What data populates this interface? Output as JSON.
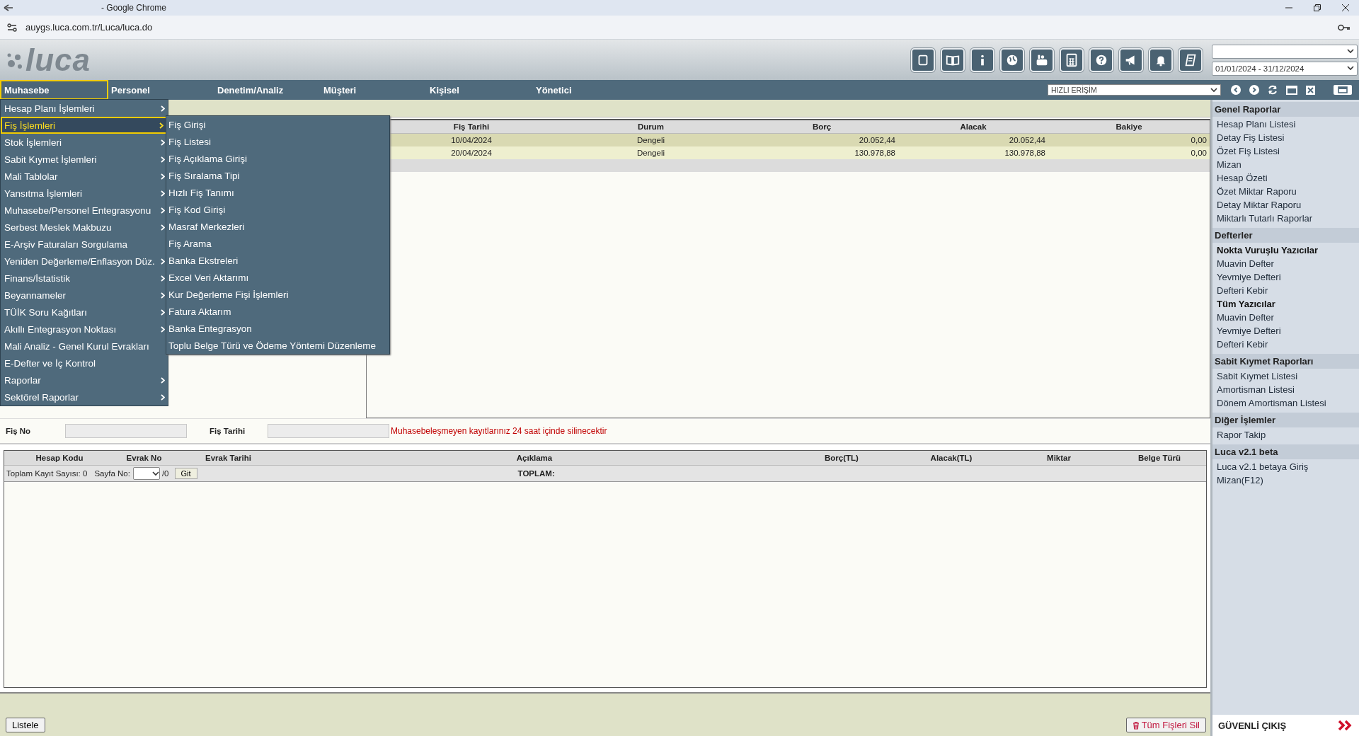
{
  "browser": {
    "title": "- Google Chrome",
    "url": "auygs.luca.com.tr/Luca/luca.do"
  },
  "header": {
    "logo": "luca",
    "period": "01/01/2024 - 31/12/2024"
  },
  "nav": {
    "items": [
      {
        "label": "Muhasebe",
        "selected": true
      },
      {
        "label": "Personel",
        "selected": false
      },
      {
        "label": "Denetim/Analiz",
        "selected": false
      },
      {
        "label": "Müşteri",
        "selected": false
      },
      {
        "label": "Kişisel",
        "selected": false
      },
      {
        "label": "Yönetici",
        "selected": false
      }
    ],
    "quick_access": "HIZLI ERİŞİM"
  },
  "menu": {
    "items": [
      {
        "label": "Hesap Planı İşlemleri",
        "has_submenu": true,
        "selected": false
      },
      {
        "label": "Fiş İşlemleri",
        "has_submenu": true,
        "selected": true
      },
      {
        "label": "Stok İşlemleri",
        "has_submenu": true,
        "selected": false
      },
      {
        "label": "Sabit Kıymet İşlemleri",
        "has_submenu": true,
        "selected": false
      },
      {
        "label": "Mali Tablolar",
        "has_submenu": true,
        "selected": false
      },
      {
        "label": "Yansıtma İşlemleri",
        "has_submenu": true,
        "selected": false
      },
      {
        "label": "Muhasebe/Personel Entegrasyonu",
        "has_submenu": true,
        "selected": false
      },
      {
        "label": "Serbest Meslek Makbuzu",
        "has_submenu": true,
        "selected": false
      },
      {
        "label": "E-Arşiv Faturaları Sorgulama",
        "has_submenu": false,
        "selected": false
      },
      {
        "label": "Yeniden Değerleme/Enflasyon Düz.",
        "has_submenu": true,
        "selected": false
      },
      {
        "label": "Finans/İstatistik",
        "has_submenu": true,
        "selected": false
      },
      {
        "label": "Beyannameler",
        "has_submenu": true,
        "selected": false
      },
      {
        "label": "TÜİK Soru Kağıtları",
        "has_submenu": true,
        "selected": false
      },
      {
        "label": "Akıllı Entegrasyon Noktası",
        "has_submenu": true,
        "selected": false
      },
      {
        "label": "Mali Analiz - Genel Kurul Evrakları",
        "has_submenu": false,
        "selected": false
      },
      {
        "label": "E-Defter ve İç Kontrol",
        "has_submenu": false,
        "selected": false
      },
      {
        "label": "Raporlar",
        "has_submenu": true,
        "selected": false
      },
      {
        "label": "Sektörel Raporlar",
        "has_submenu": true,
        "selected": false
      }
    ]
  },
  "submenu": {
    "items": [
      "Fiş Girişi",
      "Fiş Listesi",
      "Fiş Açıklama Girişi",
      "Fiş Sıralama Tipi",
      "Hızlı Fiş Tanımı",
      "Fiş Kod Girişi",
      "Masraf Merkezleri",
      "Fiş Arama",
      "Banka Ekstreleri",
      "Excel Veri Aktarımı",
      "Kur Değerleme Fişi İşlemleri",
      "Fatura Aktarım",
      "Banka Entegrasyon",
      "Toplu Belge Türü ve Ödeme Yöntemi Düzenleme"
    ]
  },
  "voucher_table": {
    "columns": [
      "Fiş Tarihi",
      "Durum",
      "Borç",
      "Alacak",
      "Bakiye"
    ],
    "rows": [
      [
        "10/04/2024",
        "Dengeli",
        "20.052,44",
        "20.052,44",
        "0,00"
      ],
      [
        "20/04/2024",
        "Dengeli",
        "130.978,88",
        "130.978,88",
        "0,00"
      ]
    ]
  },
  "form": {
    "fields": [
      {
        "label": "Fiş No"
      },
      {
        "label": "Fiş Tarihi"
      }
    ],
    "warning": "Muhasebeleşmeyen kayıtlarınız 24 saat içinde silinecektir"
  },
  "detail_table": {
    "columns": [
      "Hesap Kodu",
      "Evrak No",
      "Evrak Tarihi",
      "Açıklama",
      "Borç(TL)",
      "Alacak(TL)",
      "Miktar",
      "Belge Türü"
    ],
    "total_count": "Toplam Kayıt Sayısı: 0",
    "page_label": "Sayfa No:",
    "page_total": "/0",
    "go_button": "Git",
    "total_label": "TOPLAM:"
  },
  "actions": {
    "list_button": "Listele",
    "delete_all_button": "Tüm Fişleri Sil"
  },
  "sidebar": {
    "sections": [
      {
        "title": "Genel Raporlar",
        "items": [
          {
            "label": "Hesap Planı Listesi",
            "kind": "link"
          },
          {
            "label": "Detay Fiş Listesi",
            "kind": "link"
          },
          {
            "label": "Özet Fiş Listesi",
            "kind": "link"
          },
          {
            "label": "Mizan",
            "kind": "link"
          },
          {
            "label": "Hesap Özeti",
            "kind": "link"
          },
          {
            "label": "Özet Miktar Raporu",
            "kind": "link"
          },
          {
            "label": "Detay Miktar Raporu",
            "kind": "link"
          },
          {
            "label": "Miktarlı Tutarlı Raporlar",
            "kind": "link"
          }
        ]
      },
      {
        "title": "Defterler",
        "items": [
          {
            "label": "Nokta Vuruşlu Yazıcılar",
            "kind": "subheading"
          },
          {
            "label": "Muavin Defter",
            "kind": "link"
          },
          {
            "label": "Yevmiye Defteri",
            "kind": "link"
          },
          {
            "label": "Defteri Kebir",
            "kind": "link"
          },
          {
            "label": "Tüm Yazıcılar",
            "kind": "subheading"
          },
          {
            "label": "Muavin Defter",
            "kind": "link"
          },
          {
            "label": "Yevmiye Defteri",
            "kind": "link"
          },
          {
            "label": "Defteri Kebir",
            "kind": "link"
          }
        ]
      },
      {
        "title": "Sabit Kıymet Raporları",
        "items": [
          {
            "label": "Sabit Kıymet Listesi",
            "kind": "link"
          },
          {
            "label": "Amortisman Listesi",
            "kind": "link"
          },
          {
            "label": "Dönem Amortisman Listesi",
            "kind": "link"
          }
        ]
      },
      {
        "title": "Diğer İşlemler",
        "items": [
          {
            "label": "Rapor Takip",
            "kind": "link"
          }
        ]
      },
      {
        "title": "Luca v2.1 beta",
        "items": [
          {
            "label": "Luca v2.1 betaya Giriş",
            "kind": "link"
          },
          {
            "label": "Mizan(F12)",
            "kind": "link"
          }
        ]
      }
    ],
    "logout": "GÜVENLİ ÇIKIŞ"
  }
}
